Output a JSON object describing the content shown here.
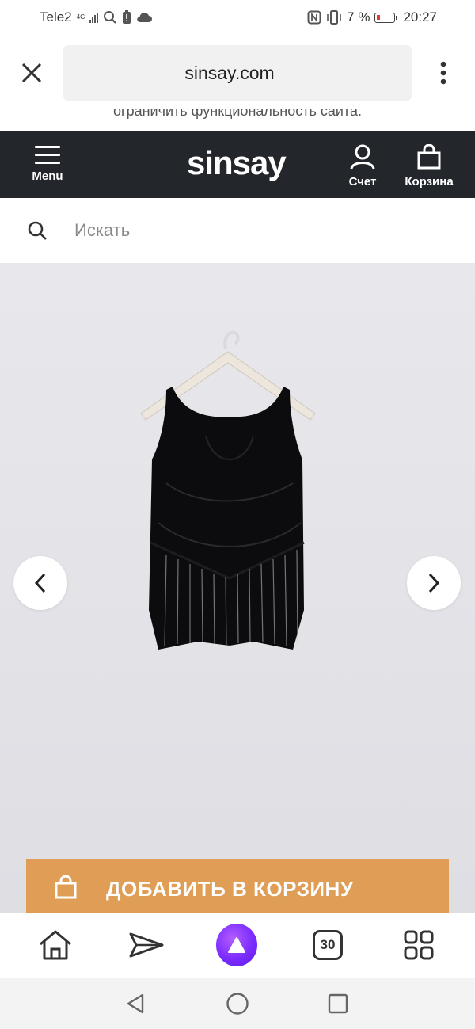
{
  "status_bar": {
    "carrier": "Tele2",
    "network": "4G",
    "battery_percent": "7 %",
    "time": "20:27"
  },
  "browser": {
    "url": "sinsay.com",
    "icons": {
      "close": "close-icon",
      "bookmark": "bookmark-icon",
      "more": "more-vertical-icon"
    }
  },
  "notice": {
    "text": "ограничить функциональность сайта."
  },
  "header": {
    "menu_label": "Menu",
    "logo_text": "sinsay",
    "account_label": "Счет",
    "cart_label": "Корзина"
  },
  "search": {
    "placeholder": "Искать"
  },
  "product": {
    "add_to_cart_label": "ДОБАВИТЬ В КОРЗИНУ",
    "button_color": "#e09d55"
  },
  "bottom_nav": {
    "tabs_count": "30",
    "items": [
      "home-icon",
      "send-icon",
      "alice-assistant-icon",
      "tabs-counter",
      "services-grid-icon"
    ]
  },
  "colors": {
    "header_bg": "#23262b",
    "accent": "#e09d55",
    "alice": "#7b2cff"
  }
}
